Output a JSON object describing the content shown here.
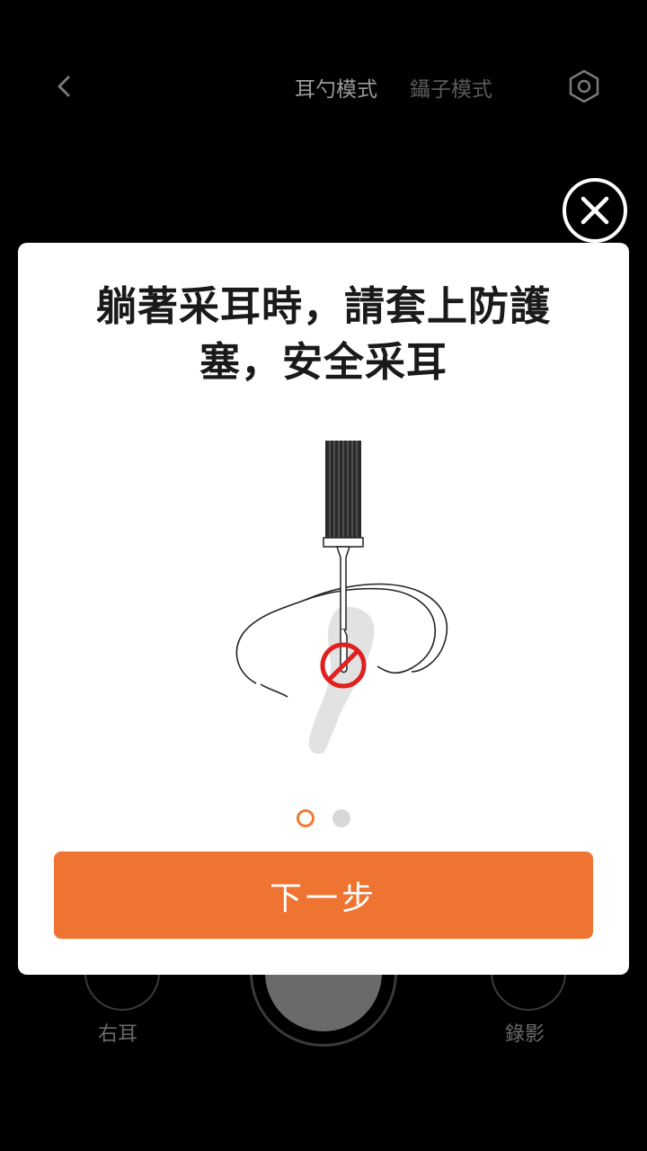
{
  "header": {
    "mode_active": "耳勺模式",
    "mode_inactive": "鑷子模式",
    "back_icon": "chevron-left-icon",
    "settings_icon": "hexagon-settings-icon"
  },
  "bottom_bar": {
    "right_ear_label": "右耳",
    "record_label": "錄影"
  },
  "dialog": {
    "title_line1": "躺著采耳時，請套上防護",
    "title_line2": "塞，安全采耳",
    "next_button": "下一步",
    "close_icon": "close-circle-icon",
    "page_count": 2,
    "current_page": 1
  },
  "colors": {
    "accent": "#ef7432",
    "warning_red": "#e0201e",
    "background": "#000000",
    "dialog_bg": "#ffffff"
  }
}
